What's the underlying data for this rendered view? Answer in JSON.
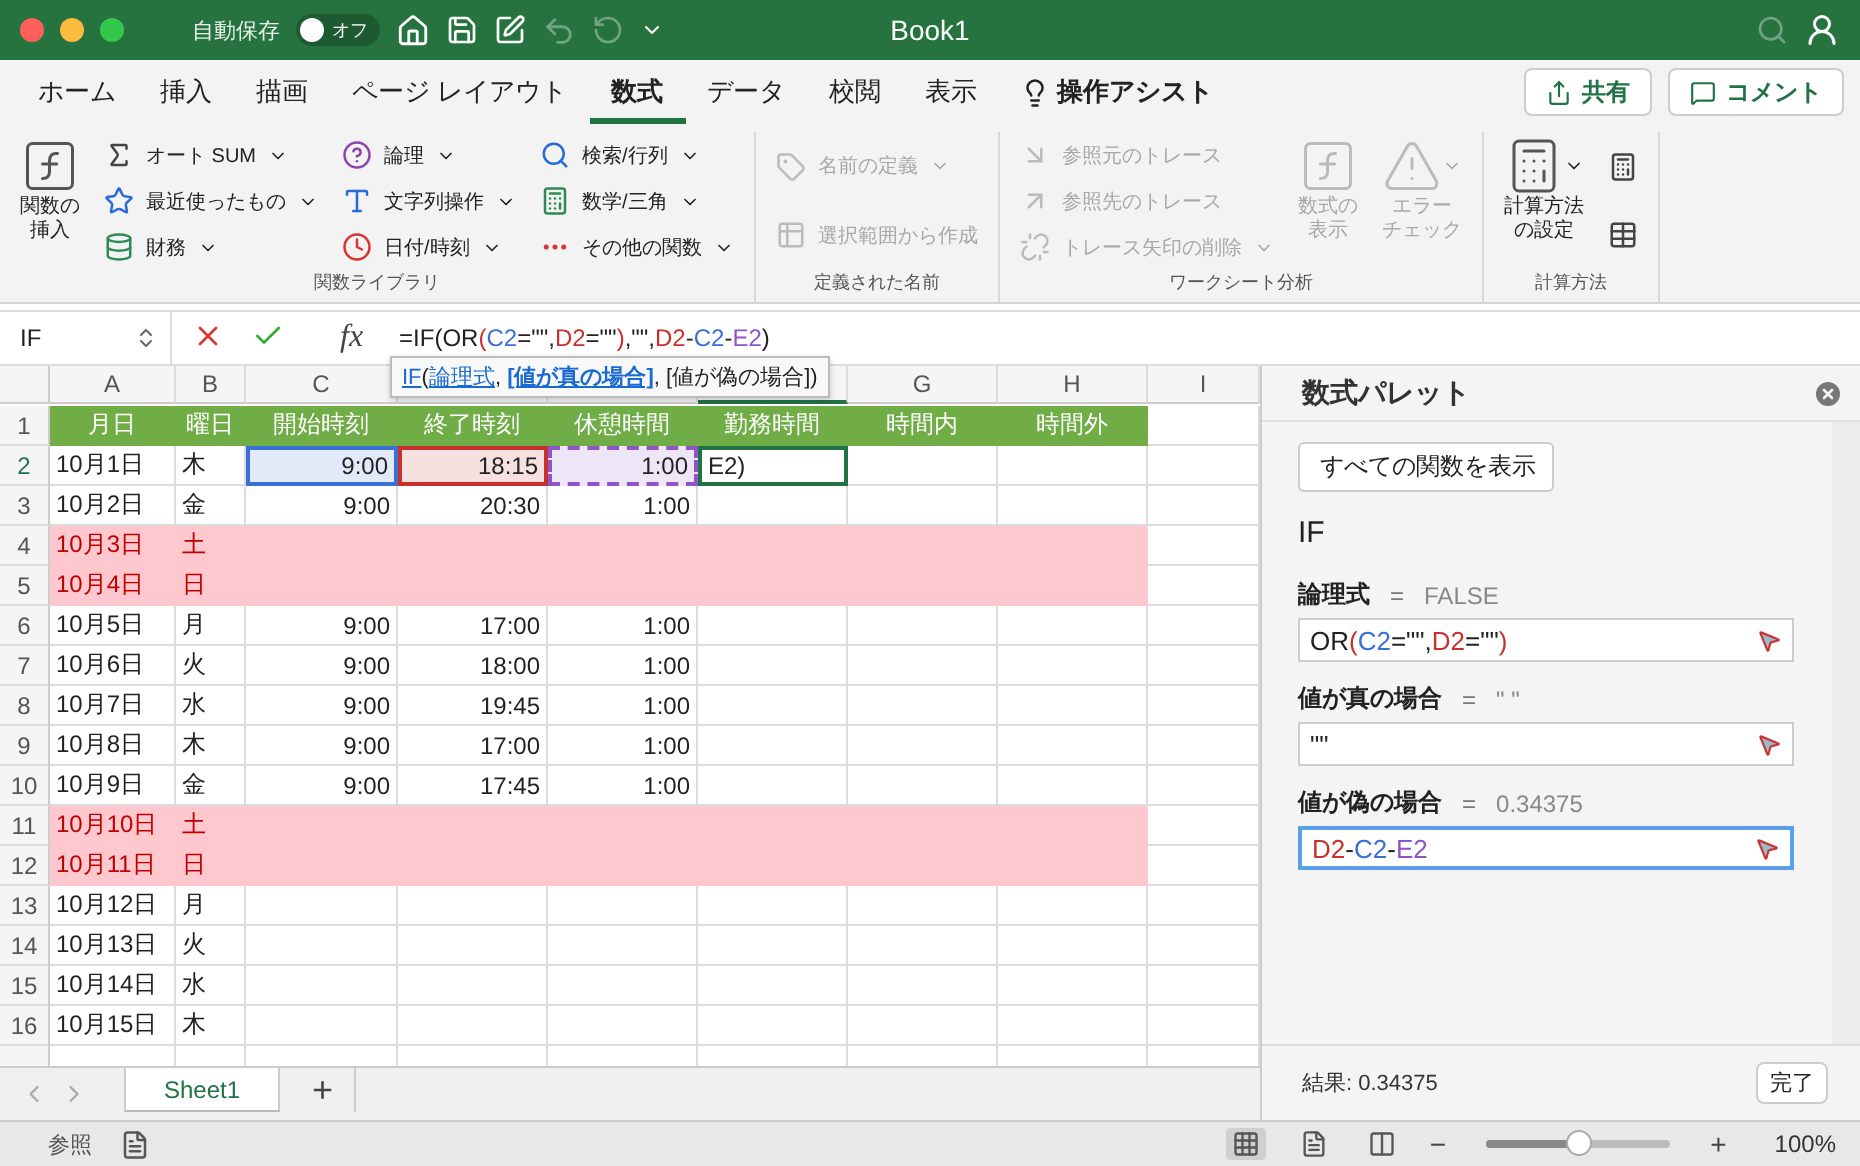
{
  "window": {
    "title": "Book1",
    "autosave": {
      "label": "自動保存",
      "state": "オフ",
      "on": false
    }
  },
  "menu_tabs": [
    {
      "label": "ホーム",
      "selected": false
    },
    {
      "label": "挿入",
      "selected": false
    },
    {
      "label": "描画",
      "selected": false
    },
    {
      "label": "ページ レイアウト",
      "selected": false
    },
    {
      "label": "数式",
      "selected": true
    },
    {
      "label": "データ",
      "selected": false
    },
    {
      "label": "校閲",
      "selected": false
    },
    {
      "label": "表示",
      "selected": false
    }
  ],
  "assist": "操作アシスト",
  "share_button": "共有",
  "comment_button": "コメント",
  "ribbon": [
    {
      "label": "関数ライブラリ",
      "items": [
        {
          "kind": "large",
          "lines": [
            "関数の",
            "挿入"
          ],
          "dropdown": false,
          "disabled": false
        },
        {
          "kind": "stack",
          "buttons": [
            {
              "label": "オート SUM",
              "dropdown": true,
              "disabled": false
            },
            {
              "label": "最近使ったもの",
              "dropdown": true,
              "disabled": false
            },
            {
              "label": "財務",
              "dropdown": true,
              "disabled": false
            }
          ]
        },
        {
          "kind": "stack",
          "buttons": [
            {
              "label": "論理",
              "dropdown": true,
              "disabled": false
            },
            {
              "label": "文字列操作",
              "dropdown": true,
              "disabled": false
            },
            {
              "label": "日付/時刻",
              "dropdown": true,
              "disabled": false
            }
          ]
        },
        {
          "kind": "stack",
          "buttons": [
            {
              "label": "検索/行列",
              "dropdown": true,
              "disabled": false
            },
            {
              "label": "数学/三角",
              "dropdown": true,
              "disabled": false
            },
            {
              "label": "その他の関数",
              "dropdown": true,
              "disabled": false
            }
          ]
        }
      ]
    },
    {
      "label": "定義された名前",
      "items": [
        {
          "kind": "stack",
          "buttons": [
            {
              "label": "名前の定義",
              "dropdown": true,
              "disabled": true
            },
            {
              "label": "選択範囲から作成",
              "dropdown": false,
              "disabled": true
            }
          ]
        }
      ]
    },
    {
      "label": "ワークシート分析",
      "items": [
        {
          "kind": "stack",
          "buttons": [
            {
              "label": "参照元のトレース",
              "dropdown": false,
              "disabled": true
            },
            {
              "label": "参照先のトレース",
              "dropdown": false,
              "disabled": true
            },
            {
              "label": "トレース矢印の削除",
              "dropdown": true,
              "disabled": true
            }
          ]
        },
        {
          "kind": "large",
          "lines": [
            "数式の",
            "表示"
          ],
          "dropdown": false,
          "disabled": true
        },
        {
          "kind": "large",
          "lines": [
            "エラー",
            "チェック"
          ],
          "dropdown": true,
          "disabled": true
        }
      ]
    },
    {
      "label": "計算方法",
      "items": [
        {
          "kind": "large",
          "lines": [
            "計算方法",
            "の設定"
          ],
          "dropdown": true,
          "disabled": false
        },
        {
          "kind": "stack",
          "buttons": [
            {
              "dropdown": false,
              "disabled": false
            },
            {
              "dropdown": false,
              "disabled": false
            }
          ]
        }
      ]
    }
  ],
  "formula_bar": {
    "name_box": "IF",
    "insert_function": "fx",
    "parts": [
      {
        "text": "=IF(OR",
        "color": "#222222"
      },
      {
        "text": "(",
        "color": "#c9302c"
      },
      {
        "text": "C2",
        "color": "#3a6fd6"
      },
      {
        "text": "=\"\",",
        "color": "#222222"
      },
      {
        "text": "D2",
        "color": "#c9302c"
      },
      {
        "text": "=\"\"",
        "color": "#222222"
      },
      {
        "text": ")",
        "color": "#c9302c"
      },
      {
        "text": ",\"\",",
        "color": "#222222"
      },
      {
        "text": "D2",
        "color": "#c9302c"
      },
      {
        "text": "-",
        "color": "#222222"
      },
      {
        "text": "C2",
        "color": "#3a6fd6"
      },
      {
        "text": "-",
        "color": "#222222"
      },
      {
        "text": "E2",
        "color": "#8e55c9"
      },
      {
        "text": ")",
        "color": "#222222"
      }
    ]
  },
  "tooltip": [
    {
      "text": "IF",
      "kind": "link"
    },
    {
      "text": "(",
      "kind": "plain"
    },
    {
      "text": "論理式",
      "kind": "link"
    },
    {
      "text": ", ",
      "kind": "plain"
    },
    {
      "text": "[値が真の場合]",
      "kind": "current"
    },
    {
      "text": ", [値が偽の場合])",
      "kind": "plain"
    }
  ],
  "sheet": {
    "columns": [
      {
        "label": "A",
        "selected": false
      },
      {
        "label": "B",
        "selected": false
      },
      {
        "label": "C",
        "selected": false
      },
      {
        "selected": false
      },
      {
        "selected": false
      },
      {
        "selected": true
      },
      {
        "label": "G",
        "selected": false
      },
      {
        "label": "H",
        "selected": false
      },
      {
        "label": "I",
        "selected": false
      }
    ],
    "rows": [
      {
        "number": "1",
        "selected": false,
        "kind": "header",
        "cells": [
          "月日",
          "曜日",
          "開始時刻",
          "終了時刻",
          "休憩時間",
          "勤務時間",
          "時間内",
          "時間外"
        ]
      },
      {
        "number": "2",
        "selected": true,
        "kind": "weekday",
        "cells": [
          "10月1日",
          "木",
          {
            "text": "9:00",
            "color": "#3a6fd6",
            "dashed": false
          },
          {
            "text": "18:15",
            "color": "#c9302c",
            "dashed": false
          },
          {
            "text": "1:00",
            "color": "#8e55c9",
            "dashed": true
          },
          {
            "text": "E2)",
            "editing": true
          },
          "",
          ""
        ]
      },
      {
        "number": "3",
        "selected": false,
        "kind": "weekday",
        "cells": [
          "10月2日",
          "金",
          "9:00",
          "20:30",
          "1:00",
          "",
          "",
          ""
        ]
      },
      {
        "number": "4",
        "selected": false,
        "kind": "weekend",
        "cells": [
          "10月3日",
          "土",
          "",
          "",
          "",
          "",
          "",
          ""
        ]
      },
      {
        "number": "5",
        "selected": false,
        "kind": "weekend",
        "cells": [
          "10月4日",
          "日",
          "",
          "",
          "",
          "",
          "",
          ""
        ]
      },
      {
        "number": "6",
        "selected": false,
        "kind": "weekday",
        "cells": [
          "10月5日",
          "月",
          "9:00",
          "17:00",
          "1:00",
          "",
          "",
          ""
        ]
      },
      {
        "number": "7",
        "selected": false,
        "kind": "weekday",
        "cells": [
          "10月6日",
          "火",
          "9:00",
          "18:00",
          "1:00",
          "",
          "",
          ""
        ]
      },
      {
        "number": "8",
        "selected": false,
        "kind": "weekday",
        "cells": [
          "10月7日",
          "水",
          "9:00",
          "19:45",
          "1:00",
          "",
          "",
          ""
        ]
      },
      {
        "number": "9",
        "selected": false,
        "kind": "weekday",
        "cells": [
          "10月8日",
          "木",
          "9:00",
          "17:00",
          "1:00",
          "",
          "",
          ""
        ]
      },
      {
        "number": "10",
        "selected": false,
        "kind": "weekday",
        "cells": [
          "10月9日",
          "金",
          "9:00",
          "17:45",
          "1:00",
          "",
          "",
          ""
        ]
      },
      {
        "number": "11",
        "selected": false,
        "kind": "weekend",
        "cells": [
          "10月10日",
          "土",
          "",
          "",
          "",
          "",
          "",
          ""
        ]
      },
      {
        "number": "12",
        "selected": false,
        "kind": "weekend",
        "cells": [
          "10月11日",
          "日",
          "",
          "",
          "",
          "",
          "",
          ""
        ]
      },
      {
        "number": "13",
        "selected": false,
        "kind": "weekday",
        "cells": [
          "10月12日",
          "月",
          "",
          "",
          "",
          "",
          "",
          ""
        ]
      },
      {
        "number": "14",
        "selected": false,
        "kind": "weekday",
        "cells": [
          "10月13日",
          "火",
          "",
          "",
          "",
          "",
          "",
          ""
        ]
      },
      {
        "number": "15",
        "selected": false,
        "kind": "weekday",
        "cells": [
          "10月14日",
          "水",
          "",
          "",
          "",
          "",
          "",
          ""
        ]
      },
      {
        "number": "16",
        "selected": false,
        "kind": "weekday",
        "cells": [
          "10月15日",
          "木",
          "",
          "",
          "",
          "",
          "",
          ""
        ]
      }
    ]
  },
  "sheet_tabs": [
    {
      "label": "Sheet1",
      "selected": true
    }
  ],
  "add_sheet": "+",
  "palette": {
    "title": "数式パレット",
    "back_button": "すべての関数を表示",
    "function": "IF",
    "arguments": [
      {
        "label": "論理式",
        "equals": "=",
        "value": "FALSE",
        "focused": false,
        "parts": [
          {
            "text": "OR",
            "color": "#222222"
          },
          {
            "text": "(",
            "color": "#c9302c"
          },
          {
            "text": "C2",
            "color": "#3a6fd6"
          },
          {
            "text": "=\"\",",
            "color": "#222222"
          },
          {
            "text": "D2",
            "color": "#c9302c"
          },
          {
            "text": "=\"\"",
            "color": "#222222"
          },
          {
            "text": ")",
            "color": "#c9302c"
          }
        ]
      },
      {
        "label": "値が真の場合",
        "equals": "=",
        "value": "\" \"",
        "focused": false,
        "parts": [
          {
            "text": "\"\"",
            "color": "#222222"
          }
        ]
      },
      {
        "label": "値が偽の場合",
        "equals": "=",
        "value": "0.34375",
        "focused": true,
        "parts": [
          {
            "text": "D2",
            "color": "#c9302c"
          },
          {
            "text": "-",
            "color": "#222222"
          },
          {
            "text": "C2",
            "color": "#3a6fd6"
          },
          {
            "text": "-",
            "color": "#222222"
          },
          {
            "text": "E2",
            "color": "#8e55c9"
          }
        ]
      }
    ],
    "result": "結果: 0.34375",
    "done_button": "完了"
  },
  "status_bar": {
    "mode": "参照",
    "views": [
      {
        "selected": true
      },
      {
        "selected": false
      },
      {
        "selected": false
      }
    ],
    "zoom": {
      "level": 0.5,
      "minus": "−",
      "plus": "+",
      "reading": "100%"
    }
  }
}
